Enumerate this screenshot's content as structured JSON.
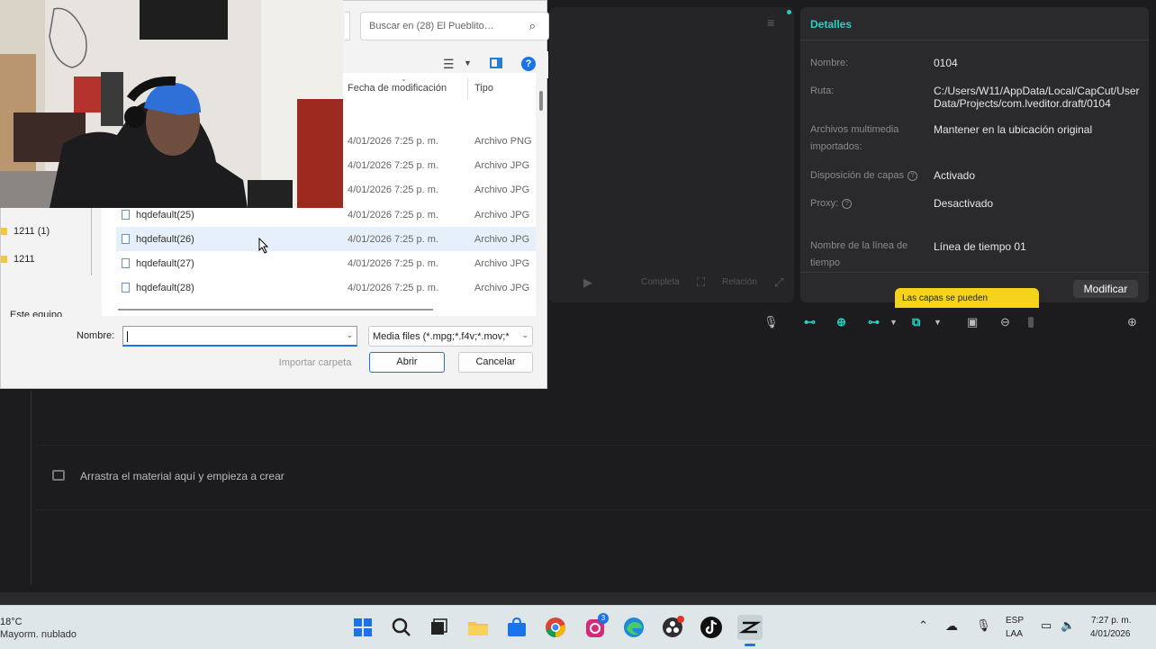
{
  "player": {
    "controls": [
      "Completa",
      "Relación"
    ]
  },
  "details": {
    "title": "Detalles",
    "fields": [
      {
        "label": "Nombre:",
        "value": "0104"
      },
      {
        "label": "Ruta:",
        "value": "C:/Users/W11/AppData/Local/CapCut/User Data/Projects/com.lveditor.draft/0104"
      },
      {
        "label": "Archivos multimedia importados:",
        "value": "Mantener en la ubicación original"
      },
      {
        "label": "Disposición de capas",
        "value": "Activado"
      },
      {
        "label": "Proxy:",
        "value": "Desactivado"
      },
      {
        "label": "Nombre de la línea de tiempo",
        "value": "Línea de tiempo 01"
      }
    ],
    "modify_label": "Modificar",
    "tooltip": "Las capas se pueden"
  },
  "timeline": {
    "drop_text": "Arrastra el material aquí y empieza a crear"
  },
  "dialog": {
    "search_placeholder": "Buscar en (28) El Pueblito…",
    "col_date": "Fecha de modificación",
    "col_type": "Tipo",
    "files": [
      {
        "name": "",
        "date": "4/01/2026 7:25 p. m.",
        "type": "Archivo PNG"
      },
      {
        "name": "",
        "date": "4/01/2026 7:25 p. m.",
        "type": "Archivo JPG"
      },
      {
        "name": "",
        "date": "4/01/2026 7:25 p. m.",
        "type": "Archivo JPG"
      },
      {
        "name": "hqdefault(25)",
        "date": "4/01/2026 7:25 p. m.",
        "type": "Archivo JPG"
      },
      {
        "name": "hqdefault(26)",
        "date": "4/01/2026 7:25 p. m.",
        "type": "Archivo JPG"
      },
      {
        "name": "hqdefault(27)",
        "date": "4/01/2026 7:25 p. m.",
        "type": "Archivo JPG"
      },
      {
        "name": "hqdefault(28)",
        "date": "4/01/2026 7:25 p. m.",
        "type": "Archivo JPG"
      }
    ],
    "tree": [
      "1211 (1)",
      "1211",
      "Este equipo"
    ],
    "name_label": "Nombre:",
    "name_value": "",
    "filter_value": "Media files (*.mpg;*.f4v;*.mov;*",
    "import_folder_label": "Importar carpeta",
    "open_label": "Abrir",
    "cancel_label": "Cancelar"
  },
  "taskbar": {
    "weather_temp": "18°C",
    "weather_desc": "Mayorm. nublado",
    "apps": [
      "start",
      "search",
      "task-view",
      "file-explorer",
      "store",
      "chrome",
      "instagram",
      "edge",
      "obs",
      "tiktok",
      "capcut"
    ],
    "instagram_badge": "3",
    "lang": "ESP",
    "layout": "LAA",
    "time": "7:27 p. m.",
    "date": "4/01/2026"
  },
  "colors": {
    "accent": "#22d3c5",
    "tooltip": "#f5d31a",
    "dialog_blue": "#1a73e8"
  }
}
